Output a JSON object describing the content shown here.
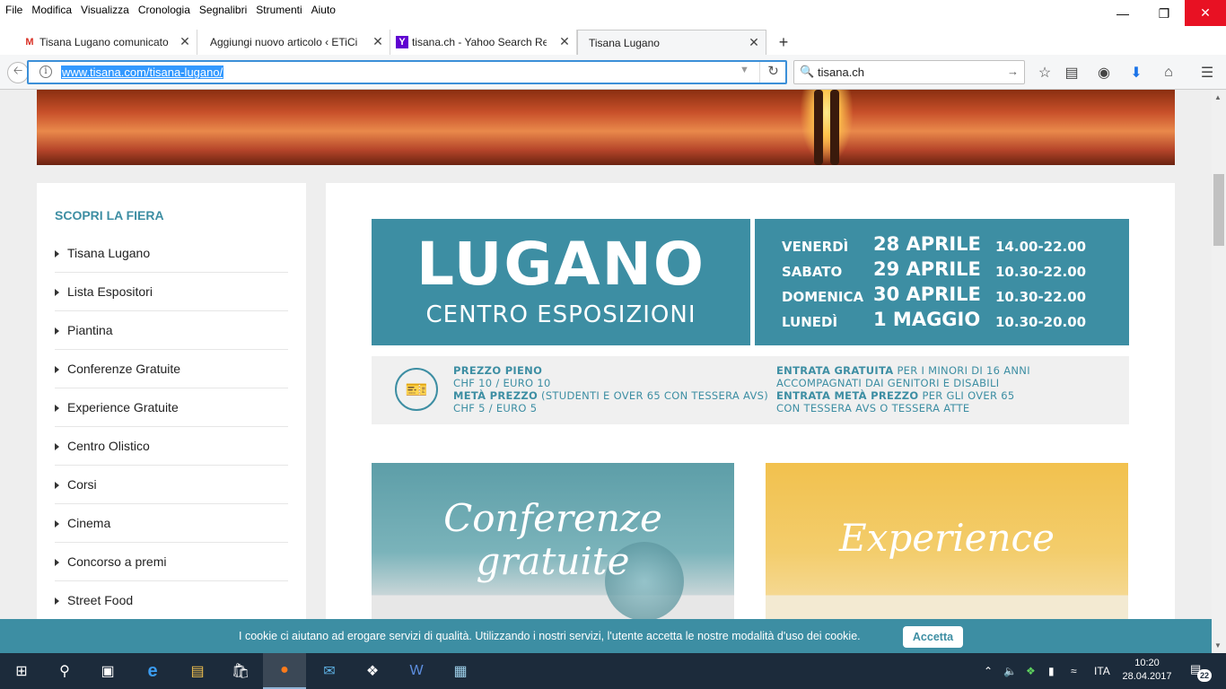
{
  "menubar": {
    "items": [
      "File",
      "Modifica",
      "Visualizza",
      "Cronologia",
      "Segnalibri",
      "Strumenti",
      "Aiuto"
    ]
  },
  "tabs": [
    {
      "label": "Tisana Lugano comunicato",
      "favicon": "M"
    },
    {
      "label": "Aggiungi nuovo articolo ‹ ETiCin",
      "favicon": ""
    },
    {
      "label": "tisana.ch - Yahoo Search Res",
      "favicon": "Y"
    },
    {
      "label": "Tisana Lugano",
      "favicon": ""
    }
  ],
  "navbar": {
    "url": "www.tisana.com/tisana-lugano/",
    "search_value": "tisana.ch"
  },
  "sidebar": {
    "title": "SCOPRI LA FIERA",
    "items": [
      "Tisana Lugano",
      "Lista Espositori",
      "Piantina",
      "Conferenze Gratuite",
      "Experience Gratuite",
      "Centro Olistico",
      "Corsi",
      "Cinema",
      "Concorso a premi",
      "Street Food"
    ]
  },
  "banner": {
    "city": "LUGANO",
    "venue": "CENTRO ESPOSIZIONI",
    "schedule": [
      {
        "day": "VENERDÌ",
        "date": "28 APRILE",
        "time": "14.00-22.00"
      },
      {
        "day": "SABATO",
        "date": "29 APRILE",
        "time": "10.30-22.00"
      },
      {
        "day": "DOMENICA",
        "date": "30 APRILE",
        "time": "10.30-22.00"
      },
      {
        "day": "LUNEDÌ",
        "date": "1 MAGGIO",
        "time": "10.30-20.00"
      }
    ]
  },
  "prices": {
    "full_label": "PREZZO PIENO",
    "full_value": "CHF 10 / EURO 10",
    "half_label": "METÀ PREZZO",
    "half_note": "(STUDENTI E OVER 65 CON TESSERA AVS)",
    "half_value": "CHF 5 / EURO 5",
    "free_label": "ENTRATA GRATUITA",
    "free_note_1": "PER I MINORI DI 16 ANNI",
    "free_note_2": "ACCOMPAGNATI DAI GENITORI E DISABILI",
    "half_entry_label": "ENTRATA METÀ PREZZO",
    "half_entry_note_1": "PER GLI OVER 65",
    "half_entry_note_2": "CON TESSERA AVS O TESSERA ATTE"
  },
  "cards": {
    "conf_line1": "Conferenze",
    "conf_line2": "gratuite",
    "exp_title": "Experience"
  },
  "cookie": {
    "text": "I cookie ci aiutano ad erogare servizi di qualità. Utilizzando i nostri servizi, l'utente accetta le nostre modalità d'uso dei cookie.",
    "accept_label": "Accetta"
  },
  "taskbar": {
    "lang": "ITA",
    "time": "10:20",
    "date": "28.04.2017",
    "notifications": "22"
  },
  "colors": {
    "accent": "#3d8ea3",
    "close_red": "#e81123",
    "taskbar": "#1c2b3b"
  }
}
